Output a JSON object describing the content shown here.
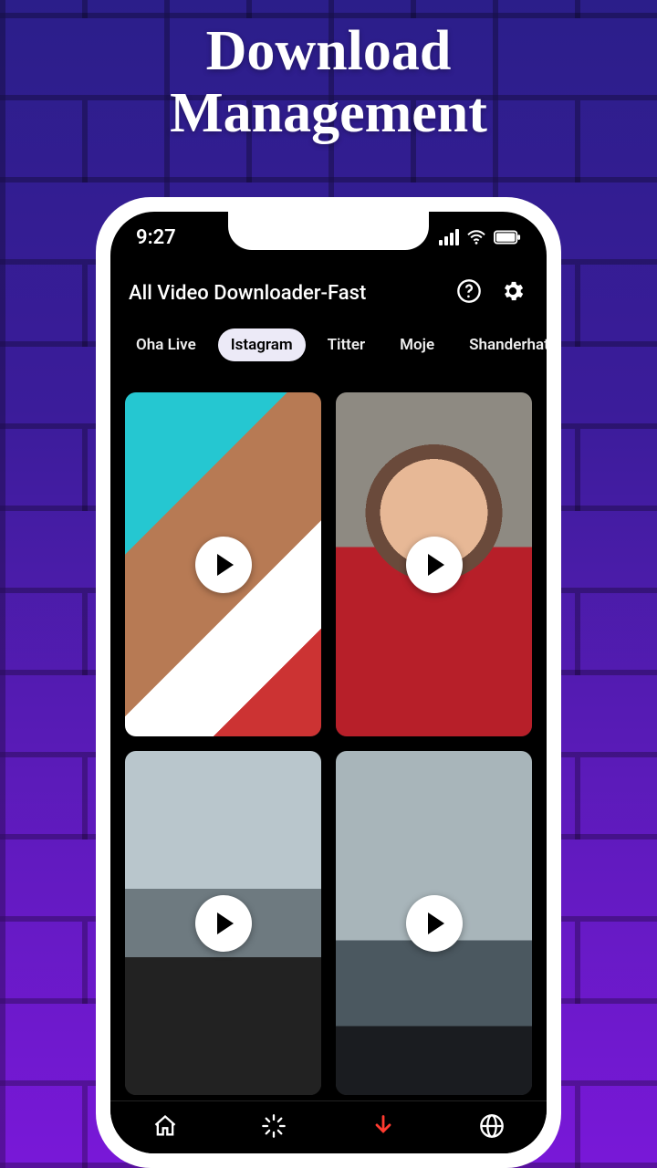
{
  "hero": {
    "line1": "Download",
    "line2": "Management"
  },
  "statusbar": {
    "time": "9:27"
  },
  "header": {
    "title": "All Video Downloader-Fast",
    "help_icon": "help-circle-icon",
    "settings_icon": "gear-icon"
  },
  "tabs": [
    {
      "label": "Oha Live",
      "active": false
    },
    {
      "label": "Istagram",
      "active": true
    },
    {
      "label": "Titter",
      "active": false
    },
    {
      "label": "Moje",
      "active": false
    },
    {
      "label": "Shanderhat",
      "active": false
    }
  ],
  "videos": [
    {
      "name": "video-1",
      "thumb_class": "t1"
    },
    {
      "name": "video-2",
      "thumb_class": "t2"
    },
    {
      "name": "video-3",
      "thumb_class": "t3"
    },
    {
      "name": "video-4",
      "thumb_class": "t4"
    }
  ],
  "nav": [
    {
      "name": "home",
      "icon": "home-icon",
      "accent": false
    },
    {
      "name": "progress",
      "icon": "spinner-icon",
      "accent": false
    },
    {
      "name": "download",
      "icon": "download-arrow-icon",
      "accent": true
    },
    {
      "name": "web",
      "icon": "globe-icon",
      "accent": false
    }
  ]
}
